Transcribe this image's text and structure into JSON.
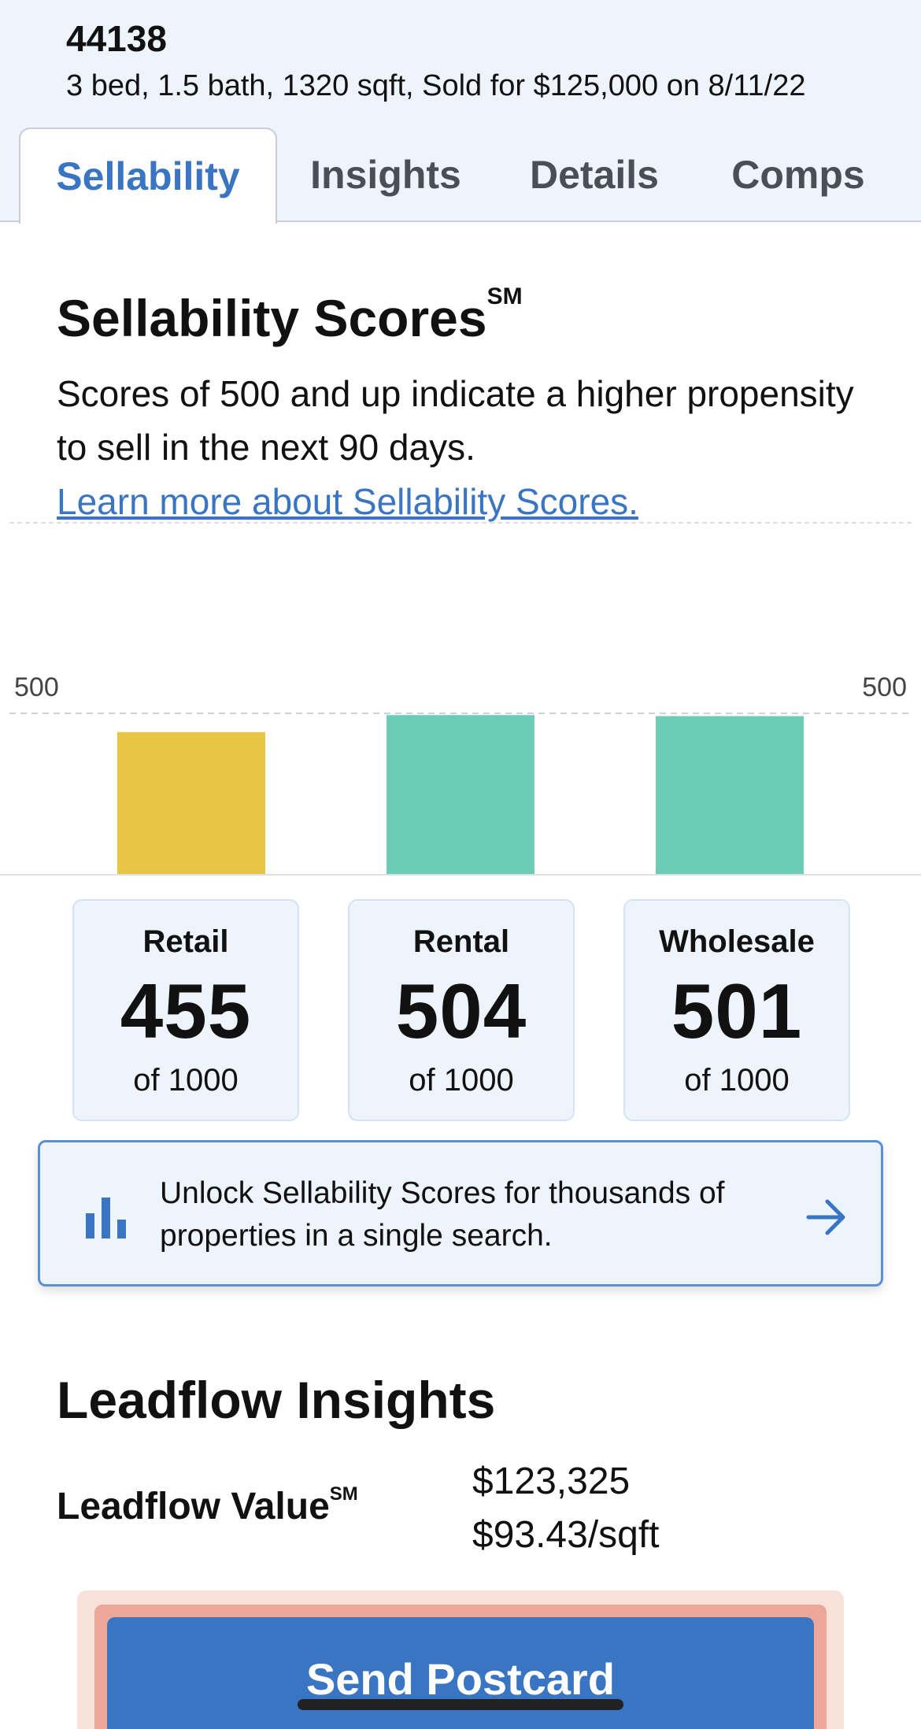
{
  "property": {
    "address_partial": "...",
    "zip": "44138",
    "summary": "3 bed, 1.5 bath, 1320 sqft, Sold for $125,000 on 8/11/22"
  },
  "tabs": [
    {
      "label": "Sellability",
      "active": true
    },
    {
      "label": "Insights",
      "active": false
    },
    {
      "label": "Details",
      "active": false
    },
    {
      "label": "Comps",
      "active": false
    }
  ],
  "sellability": {
    "title": "Sellability Scores",
    "title_mark": "SM",
    "description": "Scores of 500 and up indicate a higher propensity to sell in the next 90 days.",
    "learn_more": "Learn more about Sellability Scores."
  },
  "chart_data": {
    "type": "bar",
    "categories": [
      "Retail",
      "Rental",
      "Wholesale"
    ],
    "values": [
      455,
      504,
      501
    ],
    "reference_line": 500,
    "reference_label_left": "500",
    "reference_label_right": "500",
    "colors": [
      "#e8c544",
      "#6bcdb6",
      "#6bcdb6"
    ],
    "ylim": [
      0,
      1000
    ]
  },
  "scores": [
    {
      "label": "Retail",
      "value": "455",
      "of": "of 1000"
    },
    {
      "label": "Rental",
      "value": "504",
      "of": "of 1000"
    },
    {
      "label": "Wholesale",
      "value": "501",
      "of": "of 1000"
    }
  ],
  "unlock": {
    "icon": "bar-chart-icon",
    "text": "Unlock Sellability Scores for thousands of properties in a single search.",
    "arrow_icon": "arrow-right-icon"
  },
  "leadflow": {
    "title": "Leadflow Insights",
    "value_label": "Leadflow Value",
    "value_mark": "SM",
    "value": "$123,325",
    "per_sqft": "$93.43/sqft"
  },
  "postcard": {
    "label": "Send Postcard"
  },
  "colors": {
    "accent": "#3a75c4",
    "header_bg": "#eef4fc",
    "retail_bar": "#e8c544",
    "rental_bar": "#6bcdb6"
  }
}
